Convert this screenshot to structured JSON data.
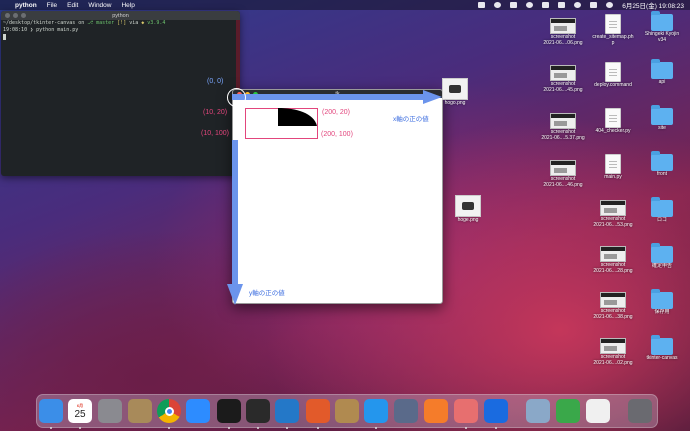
{
  "menubar": {
    "app_name": "python",
    "items": [
      "File",
      "Edit",
      "Window",
      "Help"
    ],
    "datetime": "6月25日(金) 19:08:23"
  },
  "terminal": {
    "title": "python",
    "prompt_path": "~/desktop/tkinter-canvas",
    "prompt_on": "on",
    "branch": "master",
    "branch_status": "[!]",
    "via": "via",
    "python_version": "v3.9.4",
    "time": "19:08:10",
    "command": "python main.py"
  },
  "tk_window": {
    "title": "tk"
  },
  "annotations": {
    "origin": "(0, 0)",
    "point_10_20": "(10, 20)",
    "point_10_100": "(10, 100)",
    "point_200_20": "(200, 20)",
    "point_200_100": "(200, 100)",
    "x_axis_label": "x軸の正の値",
    "y_axis_label": "y軸の正の値",
    "colors": {
      "blue": "#5b8def",
      "pink": "#e2457c"
    }
  },
  "desktop": {
    "floating_icons": [
      {
        "name": "hogo.png",
        "kind": "image"
      },
      {
        "name": "hoge.png",
        "kind": "image"
      }
    ],
    "column1": [
      {
        "name1": "screenshot",
        "name2": "2021-06....06.png",
        "kind": "screenshot"
      },
      {
        "name1": "screenshot",
        "name2": "2021-06....45.png",
        "kind": "screenshot"
      },
      {
        "name1": "screenshot",
        "name2": "2021-06....5.37.png",
        "kind": "screenshot"
      },
      {
        "name1": "screenshot",
        "name2": "2021-06....46.png",
        "kind": "screenshot"
      }
    ],
    "column2": [
      {
        "name1": "create_sitemap.ph",
        "name2": "p",
        "kind": "doc"
      },
      {
        "name1": "deploy.command",
        "name2": "",
        "kind": "doc"
      },
      {
        "name1": "404_checker.py",
        "name2": "",
        "kind": "doc"
      },
      {
        "name1": "main.py",
        "name2": "",
        "kind": "doc"
      },
      {
        "name1": "screenshot",
        "name2": "2021-06....53.png",
        "kind": "screenshot"
      },
      {
        "name1": "screenshot",
        "name2": "2021-06....28.png",
        "kind": "screenshot"
      },
      {
        "name1": "screenshot",
        "name2": "2021-06....38.png",
        "kind": "screenshot"
      },
      {
        "name1": "screenshot",
        "name2": "2021-06....02.png",
        "kind": "screenshot"
      }
    ],
    "column3": [
      {
        "name1": "Shingeki Kyojin",
        "name2": "v34",
        "kind": "folder"
      },
      {
        "name1": "api",
        "name2": "",
        "kind": "folder"
      },
      {
        "name1": "site",
        "name2": "",
        "kind": "folder"
      },
      {
        "name1": "front",
        "name2": "",
        "kind": "folder"
      },
      {
        "name1": "ロゴ",
        "name2": "",
        "kind": "folder"
      },
      {
        "name1": "確定申告",
        "name2": "",
        "kind": "folder"
      },
      {
        "name1": "保存用",
        "name2": "",
        "kind": "folder"
      },
      {
        "name1": "tkinter-canvas",
        "name2": "",
        "kind": "folder"
      }
    ]
  },
  "dock": {
    "calendar_month": "6月",
    "calendar_day": "25",
    "apps": [
      {
        "icon": "finder-icon",
        "color": "#3b8ee8"
      },
      {
        "icon": "calendar-icon",
        "color": "#ffffff"
      },
      {
        "icon": "system-preferences-icon",
        "color": "#8a8a90"
      },
      {
        "icon": "archive-utility-icon",
        "color": "#a88a5a"
      },
      {
        "icon": "chrome-icon",
        "color": "#e8e8e8"
      },
      {
        "icon": "zoom-icon",
        "color": "#2d8cff"
      },
      {
        "icon": "terminal-icon",
        "color": "#1b1b1b"
      },
      {
        "icon": "iterm-icon",
        "color": "#2a2a2a"
      },
      {
        "icon": "vscode-icon",
        "color": "#2478c8"
      },
      {
        "icon": "activity-icon",
        "color": "#e25a2a"
      },
      {
        "icon": "archive-icon",
        "color": "#b08a50"
      },
      {
        "icon": "docker-icon",
        "color": "#2496ed"
      },
      {
        "icon": "quicktime-icon",
        "color": "#5a6a8a"
      },
      {
        "icon": "sourcetree-icon",
        "color": "#f57c2a"
      },
      {
        "icon": "notes-sticky-icon",
        "color": "#e76f6f"
      },
      {
        "icon": "infinity-icon",
        "color": "#1a6be0"
      },
      {
        "icon": "preview-icon",
        "color": "#8aa8c8"
      },
      {
        "icon": "numbers-icon",
        "color": "#3aa84a"
      },
      {
        "icon": "document-icon",
        "color": "#f0f0f0"
      },
      {
        "icon": "trash-icon",
        "color": "#6a6a70"
      }
    ]
  }
}
